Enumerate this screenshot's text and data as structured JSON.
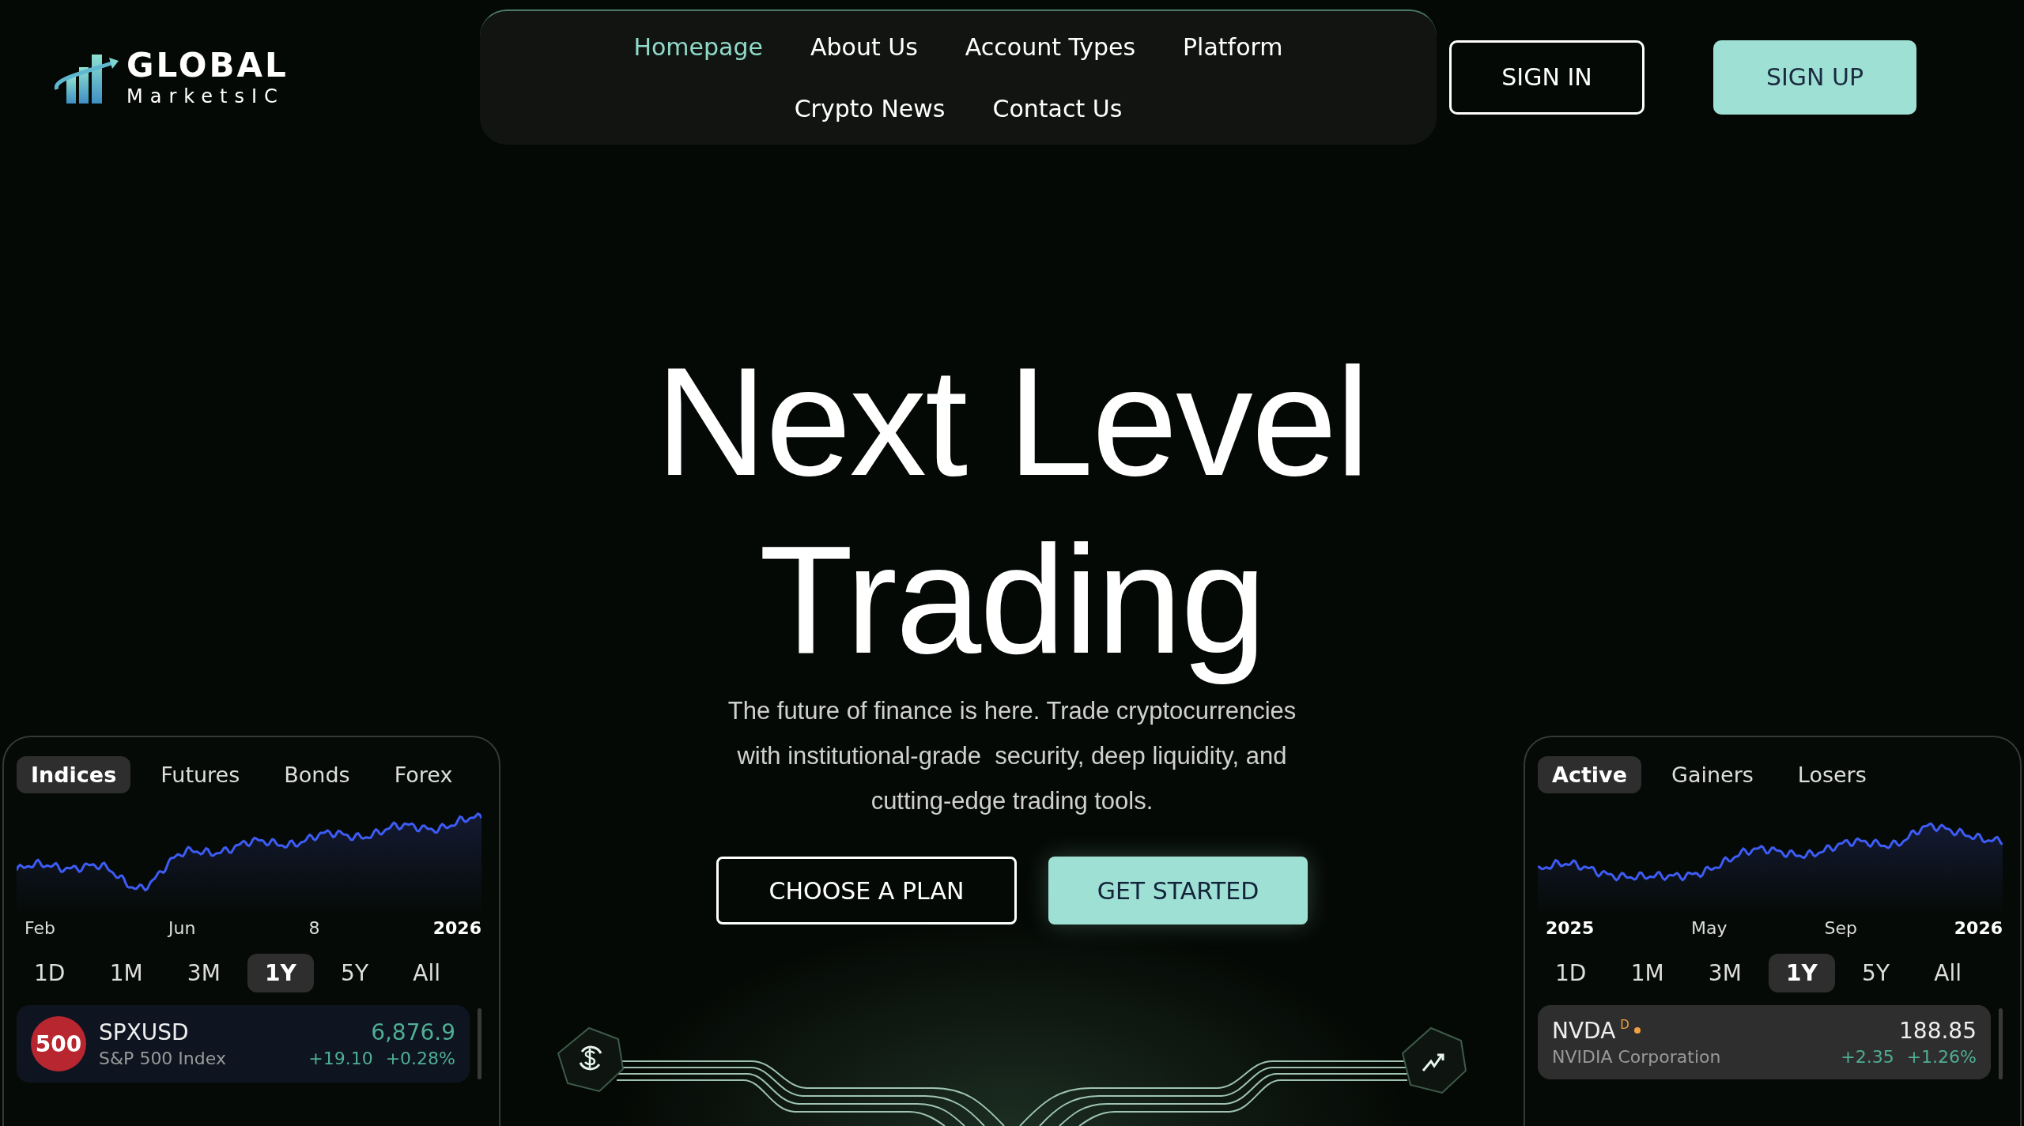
{
  "logo": {
    "title": "GLOBAL",
    "subtitle": "MarketsIC"
  },
  "nav": [
    {
      "label": "Homepage",
      "selected": true
    },
    {
      "label": "About Us",
      "selected": false
    },
    {
      "label": "Account Types",
      "selected": false
    },
    {
      "label": "Platform",
      "selected": false
    },
    {
      "label": "Crypto News",
      "selected": false
    },
    {
      "label": "Contact Us",
      "selected": false
    }
  ],
  "auth": {
    "sign_in": "SIGN IN",
    "sign_up": "SIGN UP"
  },
  "hero": {
    "title_lines": [
      "Next Level",
      "Trading"
    ],
    "subtitle_lines": [
      "The future of finance is here. Trade cryptocurrencies",
      "with institutional-grade  security, deep liquidity, and",
      "cutting-edge trading tools."
    ],
    "buttons": [
      {
        "label": "CHOOSE A PLAN",
        "kind": "outline"
      },
      {
        "label": "GET STARTED",
        "kind": "filled"
      }
    ]
  },
  "widgets": [
    {
      "tabs": [
        {
          "label": "Indices",
          "selected": true
        },
        {
          "label": "Futures",
          "selected": false
        },
        {
          "label": "Bonds",
          "selected": false
        },
        {
          "label": "Forex",
          "selected": false
        }
      ],
      "x_labels": [
        {
          "label": "Feb",
          "bold": false
        },
        {
          "label": "Jun",
          "bold": false
        },
        {
          "label": "8",
          "bold": false
        },
        {
          "label": "2026",
          "bold": true
        }
      ],
      "ranges": [
        {
          "label": "1D",
          "selected": false
        },
        {
          "label": "1M",
          "selected": false
        },
        {
          "label": "3M",
          "selected": false
        },
        {
          "label": "1Y",
          "selected": true
        },
        {
          "label": "5Y",
          "selected": false
        },
        {
          "label": "All",
          "selected": false
        }
      ],
      "quote": {
        "selected": false,
        "badge": "500",
        "symbol": "SPXUSD",
        "name": "S&P 500 Index",
        "price": "6,876.9",
        "change": "+19.10",
        "change_pct": "+0.28%"
      }
    },
    {
      "tabs": [
        {
          "label": "Active",
          "selected": true
        },
        {
          "label": "Gainers",
          "selected": false
        },
        {
          "label": "Losers",
          "selected": false
        }
      ],
      "x_labels": [
        {
          "label": "2025",
          "bold": true
        },
        {
          "label": "May",
          "bold": false
        },
        {
          "label": "Sep",
          "bold": false
        },
        {
          "label": "2026",
          "bold": true
        }
      ],
      "ranges": [
        {
          "label": "1D",
          "selected": false
        },
        {
          "label": "1M",
          "selected": false
        },
        {
          "label": "3M",
          "selected": false
        },
        {
          "label": "1Y",
          "selected": true
        },
        {
          "label": "5Y",
          "selected": false
        },
        {
          "label": "All",
          "selected": false
        }
      ],
      "quote": {
        "selected": true,
        "symbol": "NVDA",
        "flag": "D",
        "name": "NVIDIA Corporation",
        "price": "188.85",
        "change": "+2.35",
        "change_pct": "+1.26%"
      }
    }
  ]
}
